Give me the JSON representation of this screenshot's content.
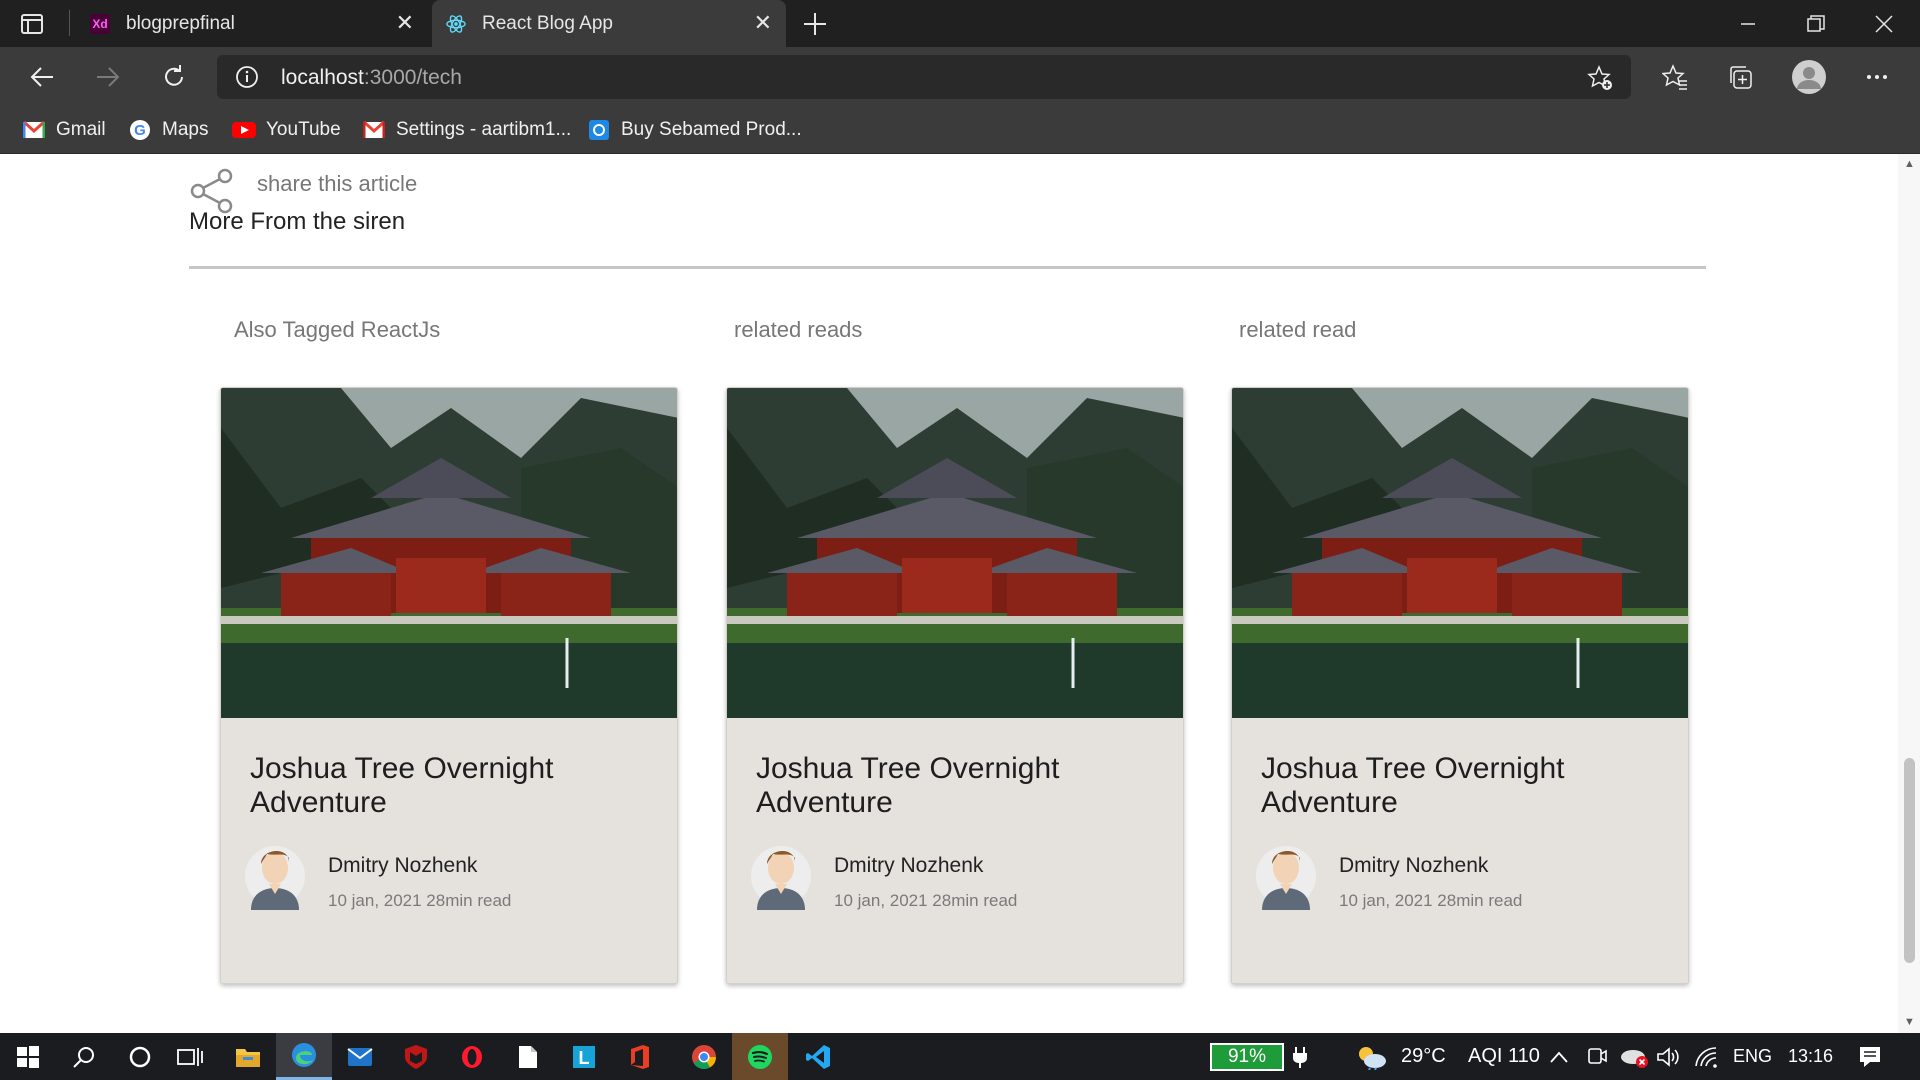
{
  "browser": {
    "tabs": [
      {
        "label": "blogprepfinal",
        "favicon": "xd-icon"
      },
      {
        "label": "React Blog App",
        "favicon": "react-icon"
      }
    ],
    "url_host": "localhost",
    "url_path": ":3000/tech",
    "bookmarks": [
      {
        "label": "Gmail",
        "icon": "gmail-icon"
      },
      {
        "label": "Maps",
        "icon": "google-icon"
      },
      {
        "label": "YouTube",
        "icon": "youtube-icon"
      },
      {
        "label": "Settings - aartibm1...",
        "icon": "gmail-icon"
      },
      {
        "label": "Buy Sebamed Prod...",
        "icon": "sebamed-icon"
      }
    ]
  },
  "article": {
    "share_label": "share this article",
    "more_title": "More From the siren"
  },
  "columns": [
    {
      "heading": "Also Tagged ReactJs",
      "card": {
        "title": "Joshua Tree Overnight Adventure",
        "author": "Dmitry Nozhenk",
        "meta": "10 jan, 2021 28min read"
      }
    },
    {
      "heading": "related reads",
      "card": {
        "title": "Joshua Tree Overnight Adventure",
        "author": "Dmitry Nozhenk",
        "meta": "10 jan, 2021 28min read"
      }
    },
    {
      "heading": "related read",
      "card": {
        "title": "Joshua Tree Overnight Adventure",
        "author": "Dmitry Nozhenk",
        "meta": "10 jan, 2021 28min read"
      }
    }
  ],
  "taskbar": {
    "battery": "91%",
    "weather": "29°C",
    "aqi": "AQI 110",
    "language": "ENG",
    "time": "13:16"
  },
  "colors": {
    "card_bg": "#e5e2dd",
    "tab_active": "#3b3b3b",
    "titlebar": "#202020",
    "taskbar": "#1b1c20"
  }
}
